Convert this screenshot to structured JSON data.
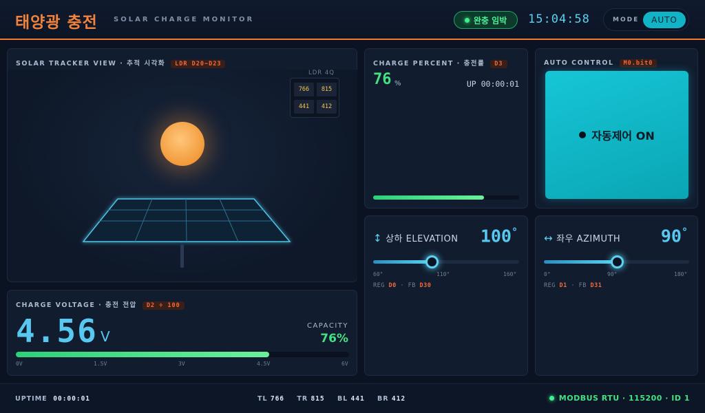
{
  "header": {
    "title": "태양광 충전",
    "subtitle": "SOLAR CHARGE MONITOR",
    "status": "완충 임박",
    "clock": "15:04:58",
    "mode_label": "MODE",
    "mode_value": "AUTO"
  },
  "tracker": {
    "title": "SOLAR TRACKER VIEW · 추적 시각화",
    "tag": "LDR D20~D23",
    "ldr_title": "LDR 4Q",
    "ldr": [
      "766",
      "815",
      "441",
      "412"
    ]
  },
  "voltage": {
    "title": "CHARGE VOLTAGE · 충전 전압",
    "tag": "D2 ÷ 100",
    "value": "4.56",
    "unit": "V",
    "capacity_label": "CAPACITY",
    "capacity_value": "76%",
    "fill_fraction": 0.76,
    "ticks": [
      "0V",
      "1.5V",
      "3V",
      "4.5V",
      "6V"
    ]
  },
  "charge": {
    "title": "CHARGE PERCENT · 충전률",
    "tag": "D3",
    "value": "76",
    "unit": "%",
    "uptime": "UP 00:00:01",
    "fill_fraction": 0.76
  },
  "auto": {
    "title": "AUTO CONTROL",
    "tag": "M0.bit0",
    "button_label": "자동제어 ON"
  },
  "elevation": {
    "arrow": "↕",
    "title": "상하 ELEVATION",
    "value": "100",
    "unit": "°",
    "min": 60,
    "max": 160,
    "current": 100,
    "ticks": [
      "60°",
      "110°",
      "160°"
    ],
    "reg_label": "REG",
    "reg": "D0",
    "fb_label": "FB",
    "fb": "D30"
  },
  "azimuth": {
    "arrow": "↔",
    "title": "좌우 AZIMUTH",
    "value": "90",
    "unit": "°",
    "min": 0,
    "max": 180,
    "current": 90,
    "ticks": [
      "0°",
      "90°",
      "180°"
    ],
    "reg_label": "REG",
    "reg": "D1",
    "fb_label": "FB",
    "fb": "D31"
  },
  "footer": {
    "uptime_label": "UPTIME",
    "uptime_value": "00:00:01",
    "tl_label": "TL",
    "tl": "766",
    "tr_label": "TR",
    "tr": "815",
    "bl_label": "BL",
    "bl": "441",
    "br_label": "BR",
    "br": "412",
    "modbus": "MODBUS RTU · 115200 · ID 1"
  }
}
